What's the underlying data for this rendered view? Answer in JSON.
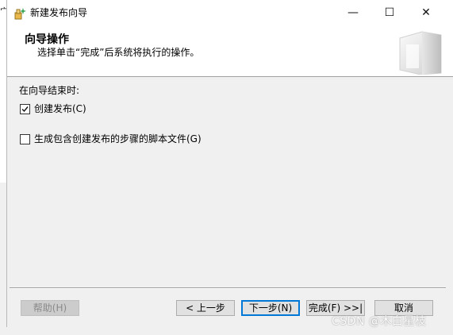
{
  "backdrop": {
    "edge_text": "宀"
  },
  "window": {
    "title": "新建发布向导",
    "controls": {
      "minimize": "—",
      "maximize": "☐",
      "close": "✕"
    }
  },
  "header": {
    "title": "向导操作",
    "subtitle": "选择单击“完成”后系统将执行的操作。"
  },
  "body": {
    "label": "在向导结束时:",
    "options": [
      {
        "label": "创建发布(C)",
        "checked": true
      },
      {
        "label": "生成包含创建发布的步骤的脚本文件(G)",
        "checked": false
      }
    ]
  },
  "buttons": {
    "help": "帮助(H)",
    "prev": "< 上一步",
    "next": "下一步(N)",
    "finish": "完成(F) >>|",
    "cancel": "取消"
  },
  "watermark": "CSDN @木白星枝",
  "colors": {
    "accent": "#0078d7",
    "window_bg": "#f0f0f0",
    "header_bg": "#ffffff"
  }
}
